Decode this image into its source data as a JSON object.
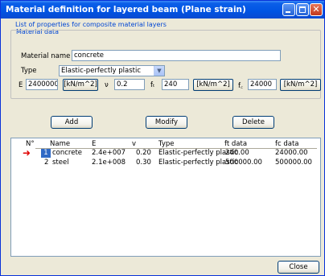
{
  "window": {
    "title": "Material definition for layered beam (Plane strain)",
    "close_label": "Close"
  },
  "properties": {
    "group_title": "List of properties for composite material layers",
    "material_group_title": "Material data",
    "name_label": "Material name",
    "name_value": "concrete",
    "type_label": "Type",
    "type_value": "Elastic-perfectly plastic",
    "e_label": "E",
    "e_value": "2400000",
    "e_unit": "[kN/m^2]",
    "nu_label": "ν",
    "nu_value": "0.2",
    "ft_label": "fₜ",
    "ft_value": "240",
    "ft_unit": "[kN/m^2]",
    "fc_label": "f꜀",
    "fc_value": "24000",
    "fc_unit": "[kN/m^2]"
  },
  "actions": {
    "add": "Add",
    "modify": "Modify",
    "delete": "Delete"
  },
  "table": {
    "headers": [
      "N°",
      "Name",
      "E",
      "v",
      "Type",
      "ft data",
      "fc data"
    ],
    "rows": [
      {
        "n": "1",
        "name": "concrete",
        "e": "2.4e+007",
        "v": "0.20",
        "type": "Elastic-perfectly plastic",
        "ft": "240.00",
        "fc": "24000.00"
      },
      {
        "n": "2",
        "name": "steel",
        "e": "2.1e+008",
        "v": "0.30",
        "type": "Elastic-perfectly plastic",
        "ft": "500000.00",
        "fc": "500000.00"
      }
    ],
    "selected_color": "#316ac5",
    "marker_color": "#e00000"
  }
}
